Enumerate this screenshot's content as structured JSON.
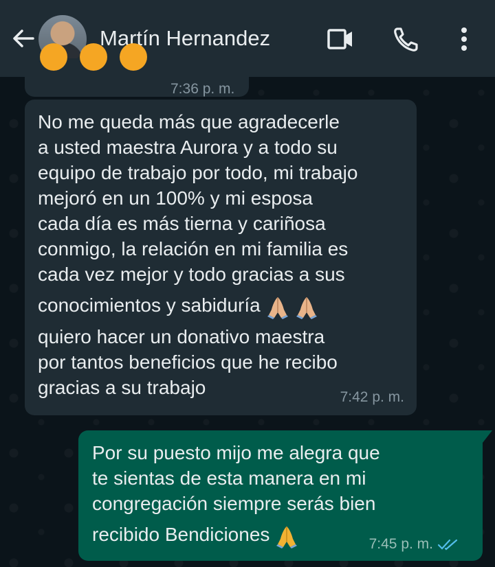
{
  "header": {
    "contact_name": "Martín Hernandez",
    "icons": [
      "back-arrow-icon",
      "video-call-icon",
      "phone-icon",
      "more-vert-icon"
    ]
  },
  "messages": [
    {
      "direction": "incoming",
      "partial": true,
      "emojis": [
        "smiley-emoji",
        "smiley-emoji",
        "smiley-emoji"
      ],
      "time": "7:36 p. m."
    },
    {
      "direction": "incoming",
      "lines": [
        "No me queda más que agradecerle",
        "a usted maestra Aurora y a todo su",
        "equipo de trabajo por todo, mi trabajo",
        "mejoró en un 100% y mi esposa",
        "cada día es más tierna y cariñosa",
        "conmigo, la relación en mi familia es",
        "cada vez mejor y todo gracias a sus",
        "conocimientos y sabiduría",
        "quiero hacer un donativo maestra",
        "por tantos beneficios que he recibo",
        "gracias a su trabajo"
      ],
      "emojis": [
        "folded-hands-emoji",
        "folded-hands-emoji"
      ],
      "time": "7:42 p. m."
    },
    {
      "direction": "outgoing",
      "lines": [
        "Por su puesto mijo me alegra que",
        "te sientas de esta manera en mi",
        "congregación siempre serás bien",
        "recibido Bendiciones"
      ],
      "emojis": [
        "folded-hands-emoji"
      ],
      "time": "7:45 p. m.",
      "status": "read-double-check"
    }
  ],
  "colors": {
    "header_bg": "#1f2c34",
    "chat_bg": "#0b141a",
    "incoming_bubble": "#1f2c34",
    "outgoing_bubble": "#005c4b",
    "read_ticks": "#53bdeb"
  }
}
